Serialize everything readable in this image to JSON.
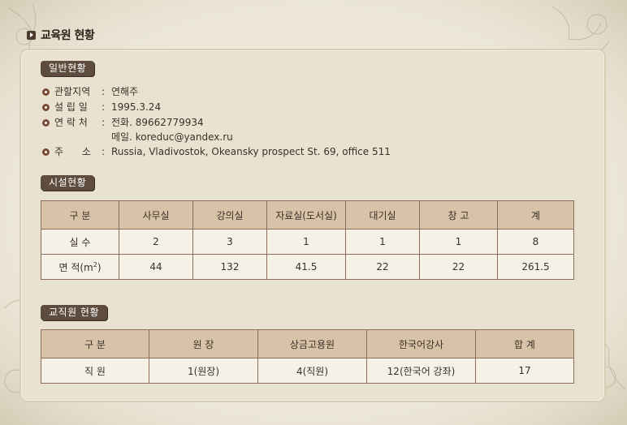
{
  "page_title": "교육원 현황",
  "general": {
    "label": "일반현황",
    "rows": [
      {
        "key": "관할지역",
        "values": [
          "연해주"
        ]
      },
      {
        "key": "설 립 일",
        "values": [
          "1995.3.24"
        ]
      },
      {
        "key": "연 락 처",
        "values": [
          "전화. 89662779934",
          "메일. koreduc@yandex.ru"
        ]
      },
      {
        "key": "주      소",
        "values": [
          "Russia, Vladivostok, Okeansky prospect St. 69, office 511"
        ]
      }
    ],
    "colon": ":"
  },
  "facilities": {
    "label": "시설현황",
    "headers": [
      "구 분",
      "사무실",
      "강의실",
      "자료실(도서실)",
      "대기실",
      "창 고",
      "계"
    ],
    "rows": [
      {
        "label": "실 수",
        "cells": [
          "2",
          "3",
          "1",
          "1",
          "1",
          "8"
        ]
      },
      {
        "label": "면 적(m",
        "label_sup": "2",
        "label_end": ")",
        "cells": [
          "44",
          "132",
          "41.5",
          "22",
          "22",
          "261.5"
        ]
      }
    ]
  },
  "staff": {
    "label": "교직원 현황",
    "headers": [
      "구 분",
      "원 장",
      "상금고용원",
      "한국어강사",
      "합 계"
    ],
    "rows": [
      {
        "label": "직 원",
        "cells": [
          "1(원장)",
          "4(직원)",
          "12(한국어 강좌)",
          "17"
        ]
      }
    ]
  },
  "colors": {
    "panel": "#eae2d0",
    "label_bg": "#5e4d3f",
    "header_bg": "#d9c3a8",
    "cell_bg": "#f6f1e6",
    "border": "#8c6d59"
  }
}
